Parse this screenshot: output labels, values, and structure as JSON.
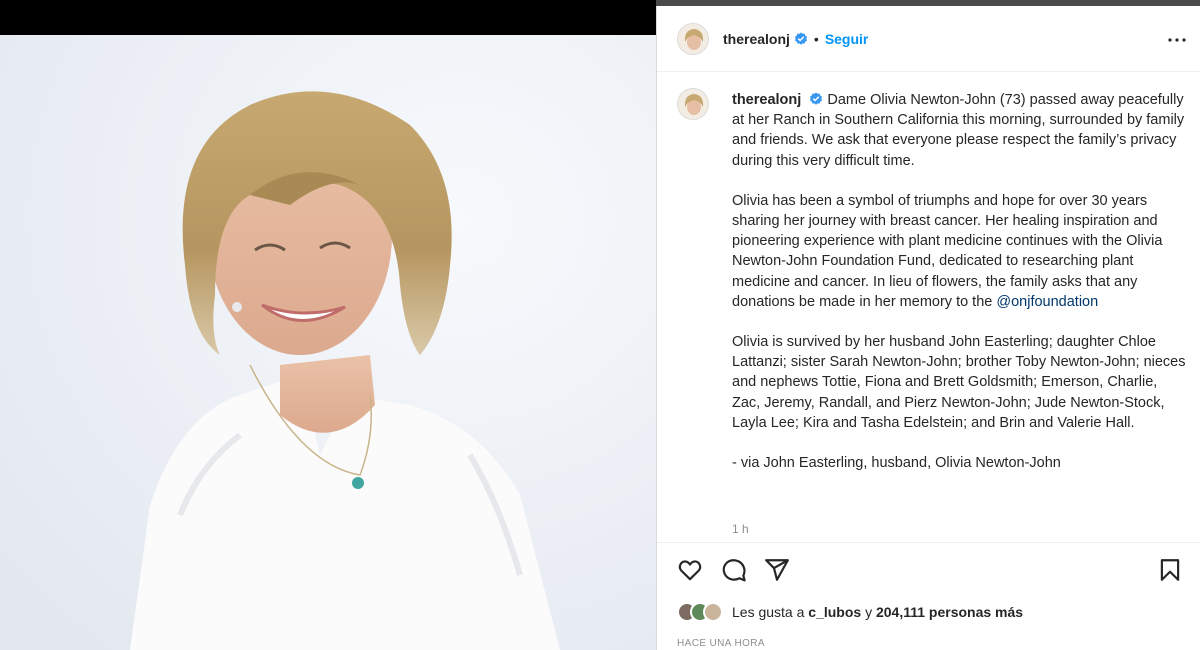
{
  "post": {
    "username": "therealonj",
    "separator": "•",
    "follow_label": "Seguir",
    "caption_lead": "Dame Olivia Newton-John (73) passed away peacefully at her Ranch in Southern California this morning, surrounded by family and friends. We ask that everyone please respect the family’s privacy during this very difficult time.",
    "paragraph2": "Olivia has been a symbol of triumphs and hope for over 30 years sharing her journey with breast cancer. Her healing inspiration and pioneering experience with plant medicine continues with the Olivia Newton-John Foundation Fund, dedicated to researching plant medicine and cancer. In lieu of flowers, the family asks that any donations be made in her memory to the",
    "mention": "@onjfoundation",
    "paragraph3": "Olivia is survived by her husband John Easterling; daughter Chloe Lattanzi; sister Sarah Newton-John; brother Toby Newton-John; nieces and nephews Tottie, Fiona and Brett Goldsmith; Emerson, Charlie, Zac, Jeremy, Randall, and Pierz Newton-John; Jude Newton-Stock, Layla Lee; Kira and Tasha Edelstein; and Brin and Valerie Hall.",
    "signature": "- via John Easterling, husband, Olivia Newton-John",
    "caption_time": "1 h"
  },
  "likes": {
    "prefix": "Les gusta a",
    "user": "c_lubos",
    "conjunction": "y",
    "count_text": "204,111 personas más"
  },
  "posted_time": "HACE UNA HORA",
  "colors": {
    "accent": "#0095f6",
    "verified": "#3897f0",
    "mention": "#00376b"
  },
  "icons": [
    "verified-badge-icon",
    "more-options-icon",
    "heart-icon",
    "comment-icon",
    "share-icon",
    "save-icon"
  ]
}
